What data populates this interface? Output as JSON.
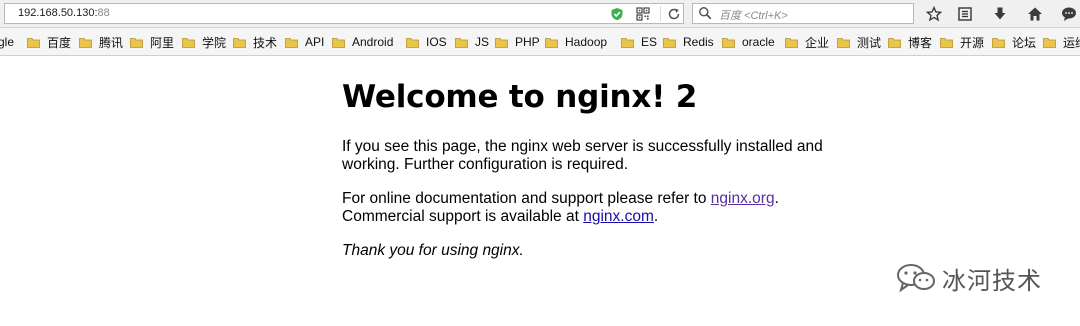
{
  "address_bar": {
    "host": "192.168.50.130:",
    "port": "88"
  },
  "search": {
    "placeholder": "百度 <Ctrl+K>"
  },
  "bookmarks": [
    "gle",
    "百度",
    "腾讯",
    "阿里",
    "学院",
    "技术",
    "API",
    "Android",
    "IOS",
    "JS",
    "PHP",
    "Hadoop",
    "ES",
    "Redis",
    "oracle",
    "企业",
    "测试",
    "博客",
    "开源",
    "论坛",
    "运维"
  ],
  "page": {
    "heading": "Welcome to nginx! 2",
    "para1": "If you see this page, the nginx web server is successfully installed and working. Further configuration is required.",
    "para2_prefix": "For online documentation and support please refer to ",
    "link1": "nginx.org",
    "para2_mid": ". Commercial support is available at ",
    "link2": "nginx.com",
    "para2_suffix": ".",
    "thanks": "Thank you for using nginx."
  },
  "watermark": {
    "text": "冰河技术"
  },
  "colors": {
    "link": "#1a0dab",
    "visited_link": "#5a2da0",
    "folder": "#e9c54b"
  }
}
